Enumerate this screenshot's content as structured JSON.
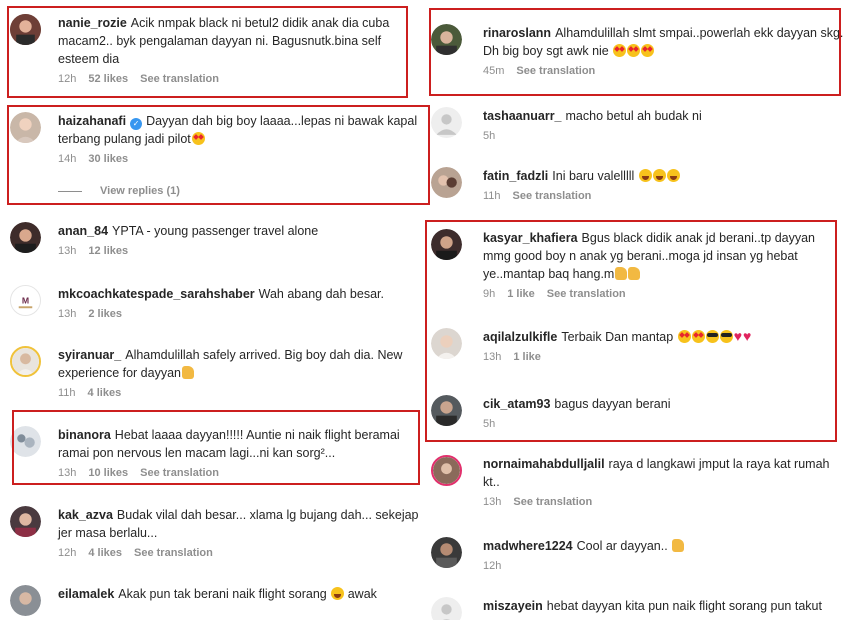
{
  "left": [
    {
      "user": "nanie_rozie",
      "text": "Acik nmpak black ni betul2 didik anak dia cuba macam2.. byk pengalaman dayyan ni. Bagusnutk.bina self esteem dia",
      "time": "12h",
      "likes": "52 likes",
      "translate": "See translation"
    },
    {
      "user": "haizahanafi",
      "verified": true,
      "text": "Dayyan dah big boy laaaa...lepas ni bawak kapal terbang pulang jadi pilot",
      "time": "14h",
      "likes": "30 likes",
      "view_replies": "View replies (1)"
    },
    {
      "user": "anan_84",
      "text": "YPTA - young passenger travel alone",
      "time": "13h",
      "likes": "12 likes"
    },
    {
      "user": "mkcoachkatespade_sarahshaber",
      "text": "Wah abang dah besar.",
      "time": "13h",
      "likes": "2 likes"
    },
    {
      "user": "syiranuar_",
      "text": "Alhamdulillah safely arrived. Big boy dah dia. New experience for dayyan",
      "time": "11h",
      "likes": "4 likes"
    },
    {
      "user": "binanora",
      "text": "Hebat laaaa dayyan!!!!! Auntie ni naik flight beramai ramai pon nervous len macam lagi...ni kan sorg²...",
      "time": "13h",
      "likes": "10 likes",
      "translate": "See translation"
    },
    {
      "user": "kak_azva",
      "text": "Budak vilal dah besar... xlama lg bujang dah... sekejap jer masa berlalu...",
      "time": "12h",
      "likes": "4 likes",
      "translate": "See translation"
    },
    {
      "user": "eilamalek",
      "text": "Akak pun tak berani naik flight sorang",
      "text2": "awak"
    }
  ],
  "right": [
    {
      "user": "rinaroslann",
      "text": "Alhamdulillah slmt smpai..powerlah ekk dayyan skg. Dh big boy sgt awk nie",
      "time": "45m",
      "translate": "See translation"
    },
    {
      "user": "tashaanuarr_",
      "text": "macho betul ah budak ni",
      "time": "5h"
    },
    {
      "user": "fatin_fadzli",
      "text": "Ini baru valelllll",
      "time": "11h",
      "translate": "See translation"
    },
    {
      "user": "kasyar_khafiera",
      "text": "Bgus black didik anak jd berani..tp dayyan mmg good boy n anak yg berani..moga jd insan yg hebat ye..mantap baq hang.m",
      "time": "9h",
      "likes": "1 like",
      "translate": "See translation"
    },
    {
      "user": "aqilalzulkifle",
      "text": "Terbaik Dan mantap",
      "time": "13h",
      "likes": "1 like"
    },
    {
      "user": "cik_atam93",
      "text": "bagus dayyan berani",
      "time": "5h"
    },
    {
      "user": "nornaimahabdulljalil",
      "text": "raya d langkawi jmput la raya kat rumah kt..",
      "time": "13h",
      "translate": "See translation"
    },
    {
      "user": "madwhere1224",
      "text": "Cool ar dayyan..",
      "time": "12h"
    },
    {
      "user": "miszayein",
      "text": "hebat dayyan kita pun naik flight sorang pun takut"
    }
  ]
}
